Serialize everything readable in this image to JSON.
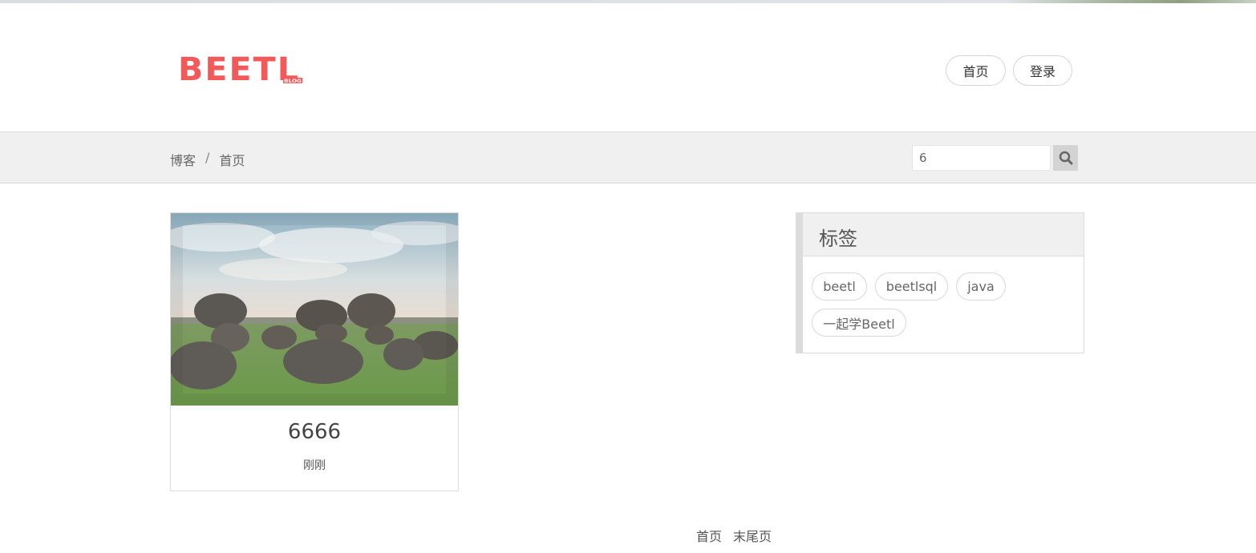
{
  "header": {
    "logo_text": "BEETL",
    "logo_subtext": "BLOG",
    "nav": {
      "home_label": "首页",
      "login_label": "登录"
    }
  },
  "breadcrumb": {
    "items": [
      "博客",
      "首页"
    ],
    "separator": "/"
  },
  "search": {
    "value": "6",
    "icon": "search-icon"
  },
  "posts": [
    {
      "title": "6666",
      "time": "刚刚",
      "image": "stones-on-grass-landscape"
    }
  ],
  "tags_panel": {
    "title": "标签",
    "tags": [
      "beetl",
      "beetlsql",
      "java",
      "一起学Beetl"
    ]
  },
  "pagination": {
    "first_label": "首页",
    "last_label": "末尾页"
  },
  "colors": {
    "brand": "#f25a5a",
    "bar_bg": "#f0f0f0",
    "border": "#dcdcdc"
  }
}
